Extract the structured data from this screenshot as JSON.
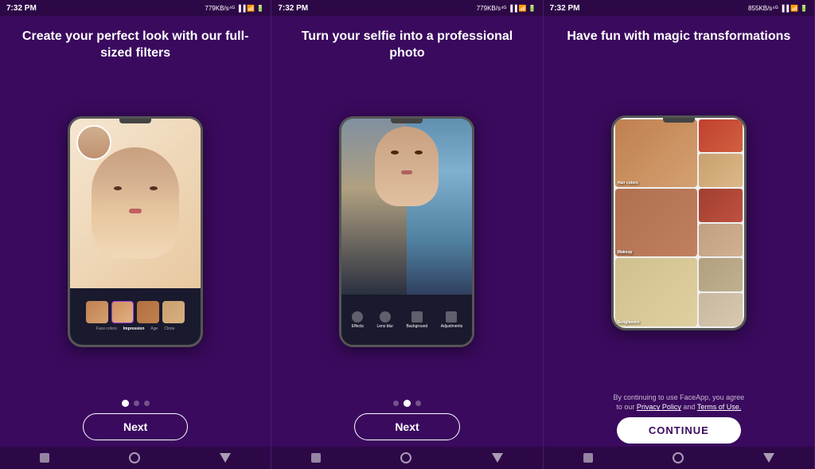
{
  "panels": [
    {
      "id": "panel-1",
      "status": {
        "time": "7:32 PM",
        "network": "779KB/s",
        "icons": "▐▐ ▐▐ ◀ ✦ 🔋"
      },
      "title": "Create your perfect look with our full-sized filters",
      "dots": [
        true,
        false,
        false
      ],
      "button": "Next",
      "nav": [
        "square",
        "circle",
        "triangle"
      ]
    },
    {
      "id": "panel-2",
      "status": {
        "time": "7:32 PM",
        "network": "779KB/s",
        "icons": "▐▐ ▐▐ ◀ ✦ 🔋"
      },
      "title": "Turn your selfie into a professional photo",
      "dots": [
        false,
        true,
        false
      ],
      "button": "Next",
      "nav": [
        "square",
        "circle",
        "triangle"
      ],
      "toolbar_items": [
        "Effects",
        "Lens blur",
        "Background",
        "Adjustments"
      ]
    },
    {
      "id": "panel-3",
      "status": {
        "time": "7:32 PM",
        "network": "855KB/s",
        "icons": "▐▐ ▐▐ ◀ ✦ 🔋"
      },
      "title": "Have fun with magic transformations",
      "grid_labels": [
        "Hair colors",
        "Makeup",
        "Sunglasses"
      ],
      "privacy_text": "By continuing to use FaceApp, you agree to our Privacy Policy and Terms of Use.",
      "button": "CONTINUE",
      "nav": [
        "square",
        "circle",
        "triangle"
      ]
    }
  ]
}
